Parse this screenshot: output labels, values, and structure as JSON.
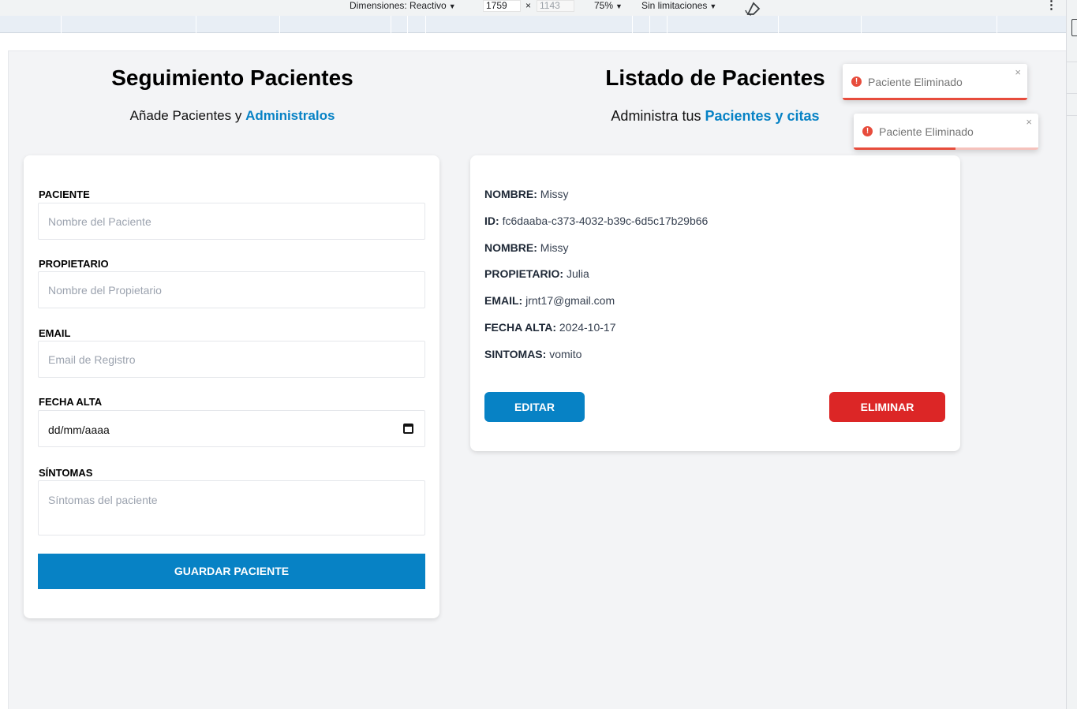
{
  "devtools": {
    "dimensions_label": "Dimensiones: Reactivo",
    "width_value": "1759",
    "times": "×",
    "height_value": "1143",
    "zoom": "75%",
    "throttling": "Sin limitaciones",
    "caret": "▼",
    "more": "⋮"
  },
  "form": {
    "title": "Seguimiento Pacientes",
    "subtitle_plain": "Añade Pacientes y ",
    "subtitle_accent": "Administralos",
    "fields": [
      {
        "label": "Paciente",
        "placeholder": "Nombre del Paciente"
      },
      {
        "label": "Propietario",
        "placeholder": "Nombre del Propietario"
      },
      {
        "label": "Email",
        "placeholder": "Email de Registro"
      },
      {
        "label": "Fecha Alta",
        "placeholder": "dd/mm/aaaa"
      },
      {
        "label": "Síntomas",
        "placeholder": "Síntomas del paciente"
      }
    ],
    "submit": "Guardar Paciente"
  },
  "list": {
    "title": "Listado de Pacientes",
    "subtitle_plain": "Administra tus ",
    "subtitle_accent": "Pacientes y citas",
    "patient": [
      {
        "key": "Nombre:",
        "value": "Missy"
      },
      {
        "key": "ID:",
        "value": "fc6daaba-c373-4032-b39c-6d5c17b29b66"
      },
      {
        "key": "Nombre:",
        "value": "Missy"
      },
      {
        "key": "Propietario:",
        "value": "Julia"
      },
      {
        "key": "Email:",
        "value": "jrnt17@gmail.com"
      },
      {
        "key": "Fecha Alta:",
        "value": "2024-10-17"
      },
      {
        "key": "Sintomas:",
        "value": "vomito"
      }
    ],
    "edit_label": "Editar",
    "delete_label": "Eliminar"
  },
  "toasts": [
    {
      "message": "Paciente Eliminado",
      "icon": "error-icon",
      "close": "×",
      "progress": 1.0
    },
    {
      "message": "Paciente Eliminado",
      "icon": "error-icon",
      "close": "×",
      "progress": 0.55
    }
  ],
  "colors": {
    "accent": "#0782c5",
    "danger": "#dc2626",
    "toast_error": "#e74c3c",
    "background": "#f3f4f6"
  }
}
